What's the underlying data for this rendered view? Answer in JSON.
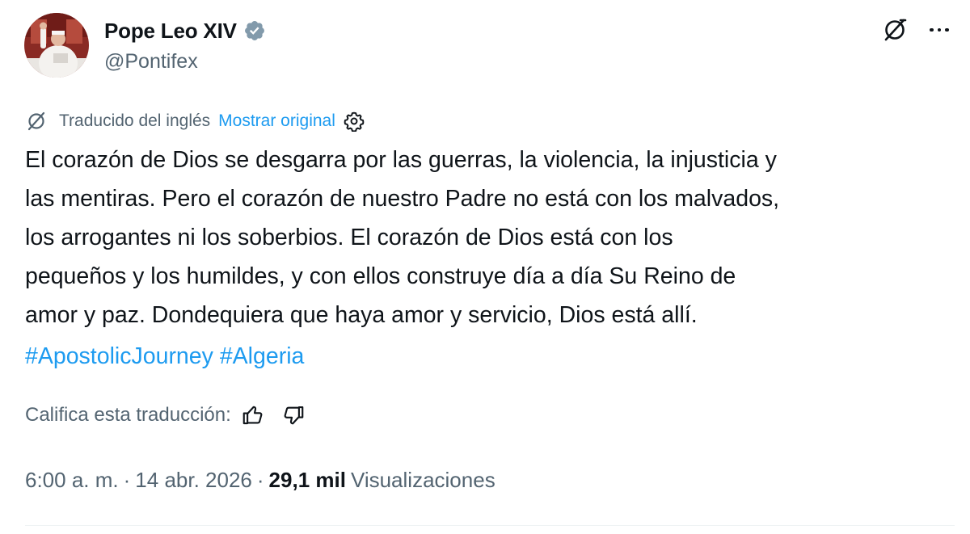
{
  "author": {
    "display_name": "Pope Leo XIV",
    "handle": "@Pontifex",
    "verified": true,
    "verified_color": "#829aab"
  },
  "icons": {
    "grok": "grok-icon",
    "more": "more-options-icon",
    "settings": "gear-icon",
    "like": "thumbs-up-icon",
    "dislike": "thumbs-down-icon"
  },
  "translation": {
    "label": "Traducido del inglés",
    "show_original": "Mostrar original"
  },
  "tweet": {
    "text": "El corazón de Dios se desgarra por las guerras, la violencia, la injusticia y\nlas mentiras. Pero el corazón de nuestro Padre no está con los malvados,\nlos arrogantes ni los soberbios. El corazón de Dios está con los\npequeños y los humildes, y con ellos construye día a día Su Reino de\namor y paz. Dondequiera que haya amor y servicio, Dios está allí.",
    "hashtags": [
      "#ApostolicJourney",
      "#Algeria"
    ]
  },
  "rating": {
    "label": "Califica esta traducción:"
  },
  "meta": {
    "time": "6:00 a. m.",
    "separator": "·",
    "date": "14 abr. 2026",
    "views_count": "29,1 mil",
    "views_label": "Visualizaciones"
  },
  "colors": {
    "text": "#0f1419",
    "secondary": "#536471",
    "link": "#1d9bf0"
  }
}
